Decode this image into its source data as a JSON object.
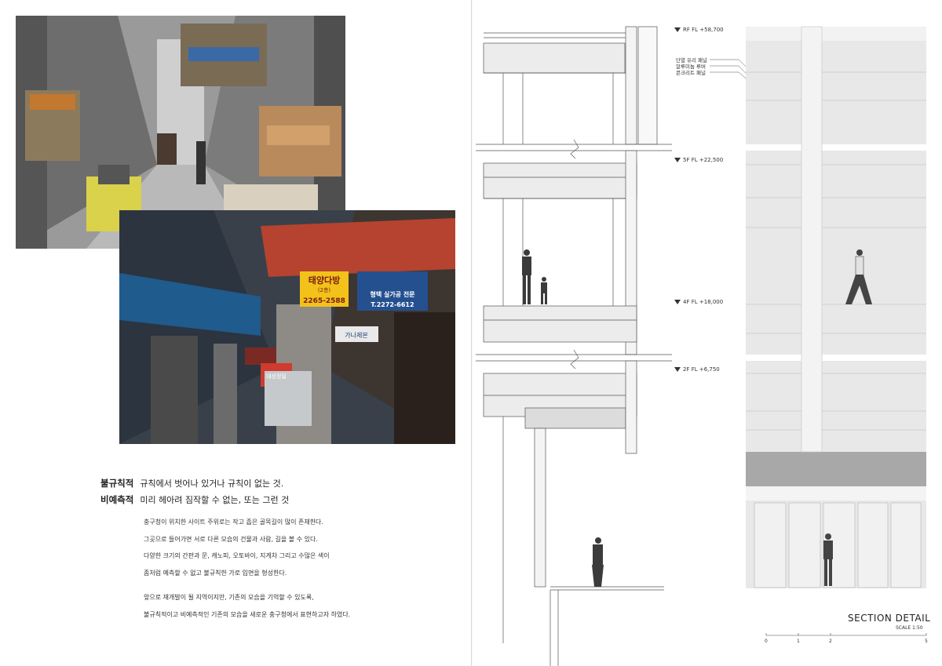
{
  "definitions": [
    {
      "term": "불규칙적",
      "text": "규칙에서 벗어나 있거나 규칙이 없는 것."
    },
    {
      "term": "비예측적",
      "text": "미리 헤아려 짐작할 수 없는, 또는 그런 것"
    }
  ],
  "paragraphs": [
    "충구청이 위치한 사이트 주위로는 작고 좁은 골목길이 많이 존재한다.",
    "그곳으로 들어가면 서로 다른 모습의 건물과 사람, 길을 볼 수 있다.",
    "다양한 크기의 간판과 문, 캐노피, 오토바이, 지게차 그리고 수많은 색이",
    "좀처럼 예측할 수 없고  불규칙한 가로 입면을 형성한다.",
    "앞으로 재개발이 될 지역이지만, 기존의 모습을 기억할 수 있도록,",
    "불규칙적이고 비예측적인 기존의 모습을 새로운 충구청에서 표현하고자 하였다."
  ],
  "photo_signs": {
    "sign1_line1": "태양다방",
    "sign1_line2": "(2층)",
    "sign1_phone": "2265-2588",
    "sign2_line1": "형택 실가공 전문",
    "sign2_phone": "T.2272-6612",
    "sign3": "가나제본",
    "sign4": "대성정밀"
  },
  "levels": [
    {
      "label": "RF FL +58,700"
    },
    {
      "label": "5F FL +22,500"
    },
    {
      "label": "4F FL +18,000"
    },
    {
      "label": "2F FL +6,750"
    }
  ],
  "materials": [
    "단열 유리 패널",
    "알루미늄 루버",
    "콘크리트 패널"
  ],
  "drawing": {
    "title": "SECTION DETAIL",
    "scale": "SCALE 1:50",
    "scale_ticks": [
      "0",
      "1",
      "2",
      "5"
    ]
  },
  "colors": {
    "drawing_fill": "#e6e6e6",
    "band": "#a8a8a8",
    "line": "#555555",
    "canopy_red": "#b5432f",
    "sign_yellow": "#f2c21b",
    "sign_blue": "#24508f"
  }
}
